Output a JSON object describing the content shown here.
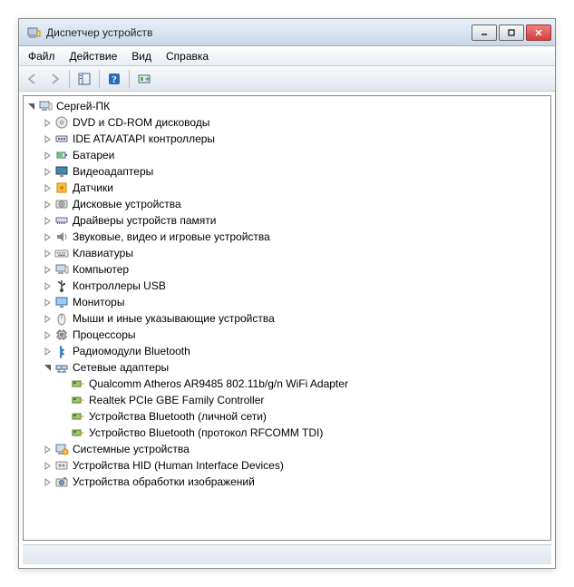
{
  "window": {
    "title": "Диспетчер устройств"
  },
  "menu": {
    "file": "Файл",
    "action": "Действие",
    "view": "Вид",
    "help": "Справка"
  },
  "tree": {
    "root": "Сергей-ПК",
    "categories": [
      {
        "label": "DVD и CD-ROM дисководы",
        "expanded": false,
        "icon": "disc"
      },
      {
        "label": "IDE ATA/ATAPI контроллеры",
        "expanded": false,
        "icon": "ide"
      },
      {
        "label": "Батареи",
        "expanded": false,
        "icon": "battery"
      },
      {
        "label": "Видеоадаптеры",
        "expanded": false,
        "icon": "display"
      },
      {
        "label": "Датчики",
        "expanded": false,
        "icon": "sensor"
      },
      {
        "label": "Дисковые устройства",
        "expanded": false,
        "icon": "hdd"
      },
      {
        "label": "Драйверы устройств памяти",
        "expanded": false,
        "icon": "memory"
      },
      {
        "label": "Звуковые, видео и игровые устройства",
        "expanded": false,
        "icon": "sound"
      },
      {
        "label": "Клавиатуры",
        "expanded": false,
        "icon": "keyboard"
      },
      {
        "label": "Компьютер",
        "expanded": false,
        "icon": "computer"
      },
      {
        "label": "Контроллеры USB",
        "expanded": false,
        "icon": "usb"
      },
      {
        "label": "Мониторы",
        "expanded": false,
        "icon": "monitor"
      },
      {
        "label": "Мыши и иные указывающие устройства",
        "expanded": false,
        "icon": "mouse"
      },
      {
        "label": "Процессоры",
        "expanded": false,
        "icon": "cpu"
      },
      {
        "label": "Радиомодули Bluetooth",
        "expanded": false,
        "icon": "bluetooth"
      },
      {
        "label": "Сетевые адаптеры",
        "expanded": true,
        "icon": "network",
        "children": [
          {
            "label": "Qualcomm Atheros AR9485 802.11b/g/n WiFi Adapter",
            "icon": "nic"
          },
          {
            "label": "Realtek PCIe GBE Family Controller",
            "icon": "nic"
          },
          {
            "label": "Устройства Bluetooth (личной сети)",
            "icon": "nic"
          },
          {
            "label": "Устройство Bluetooth (протокол RFCOMM TDI)",
            "icon": "nic"
          }
        ]
      },
      {
        "label": "Системные устройства",
        "expanded": false,
        "icon": "system"
      },
      {
        "label": "Устройства HID (Human Interface Devices)",
        "expanded": false,
        "icon": "hid"
      },
      {
        "label": "Устройства обработки изображений",
        "expanded": false,
        "icon": "imaging"
      }
    ]
  }
}
